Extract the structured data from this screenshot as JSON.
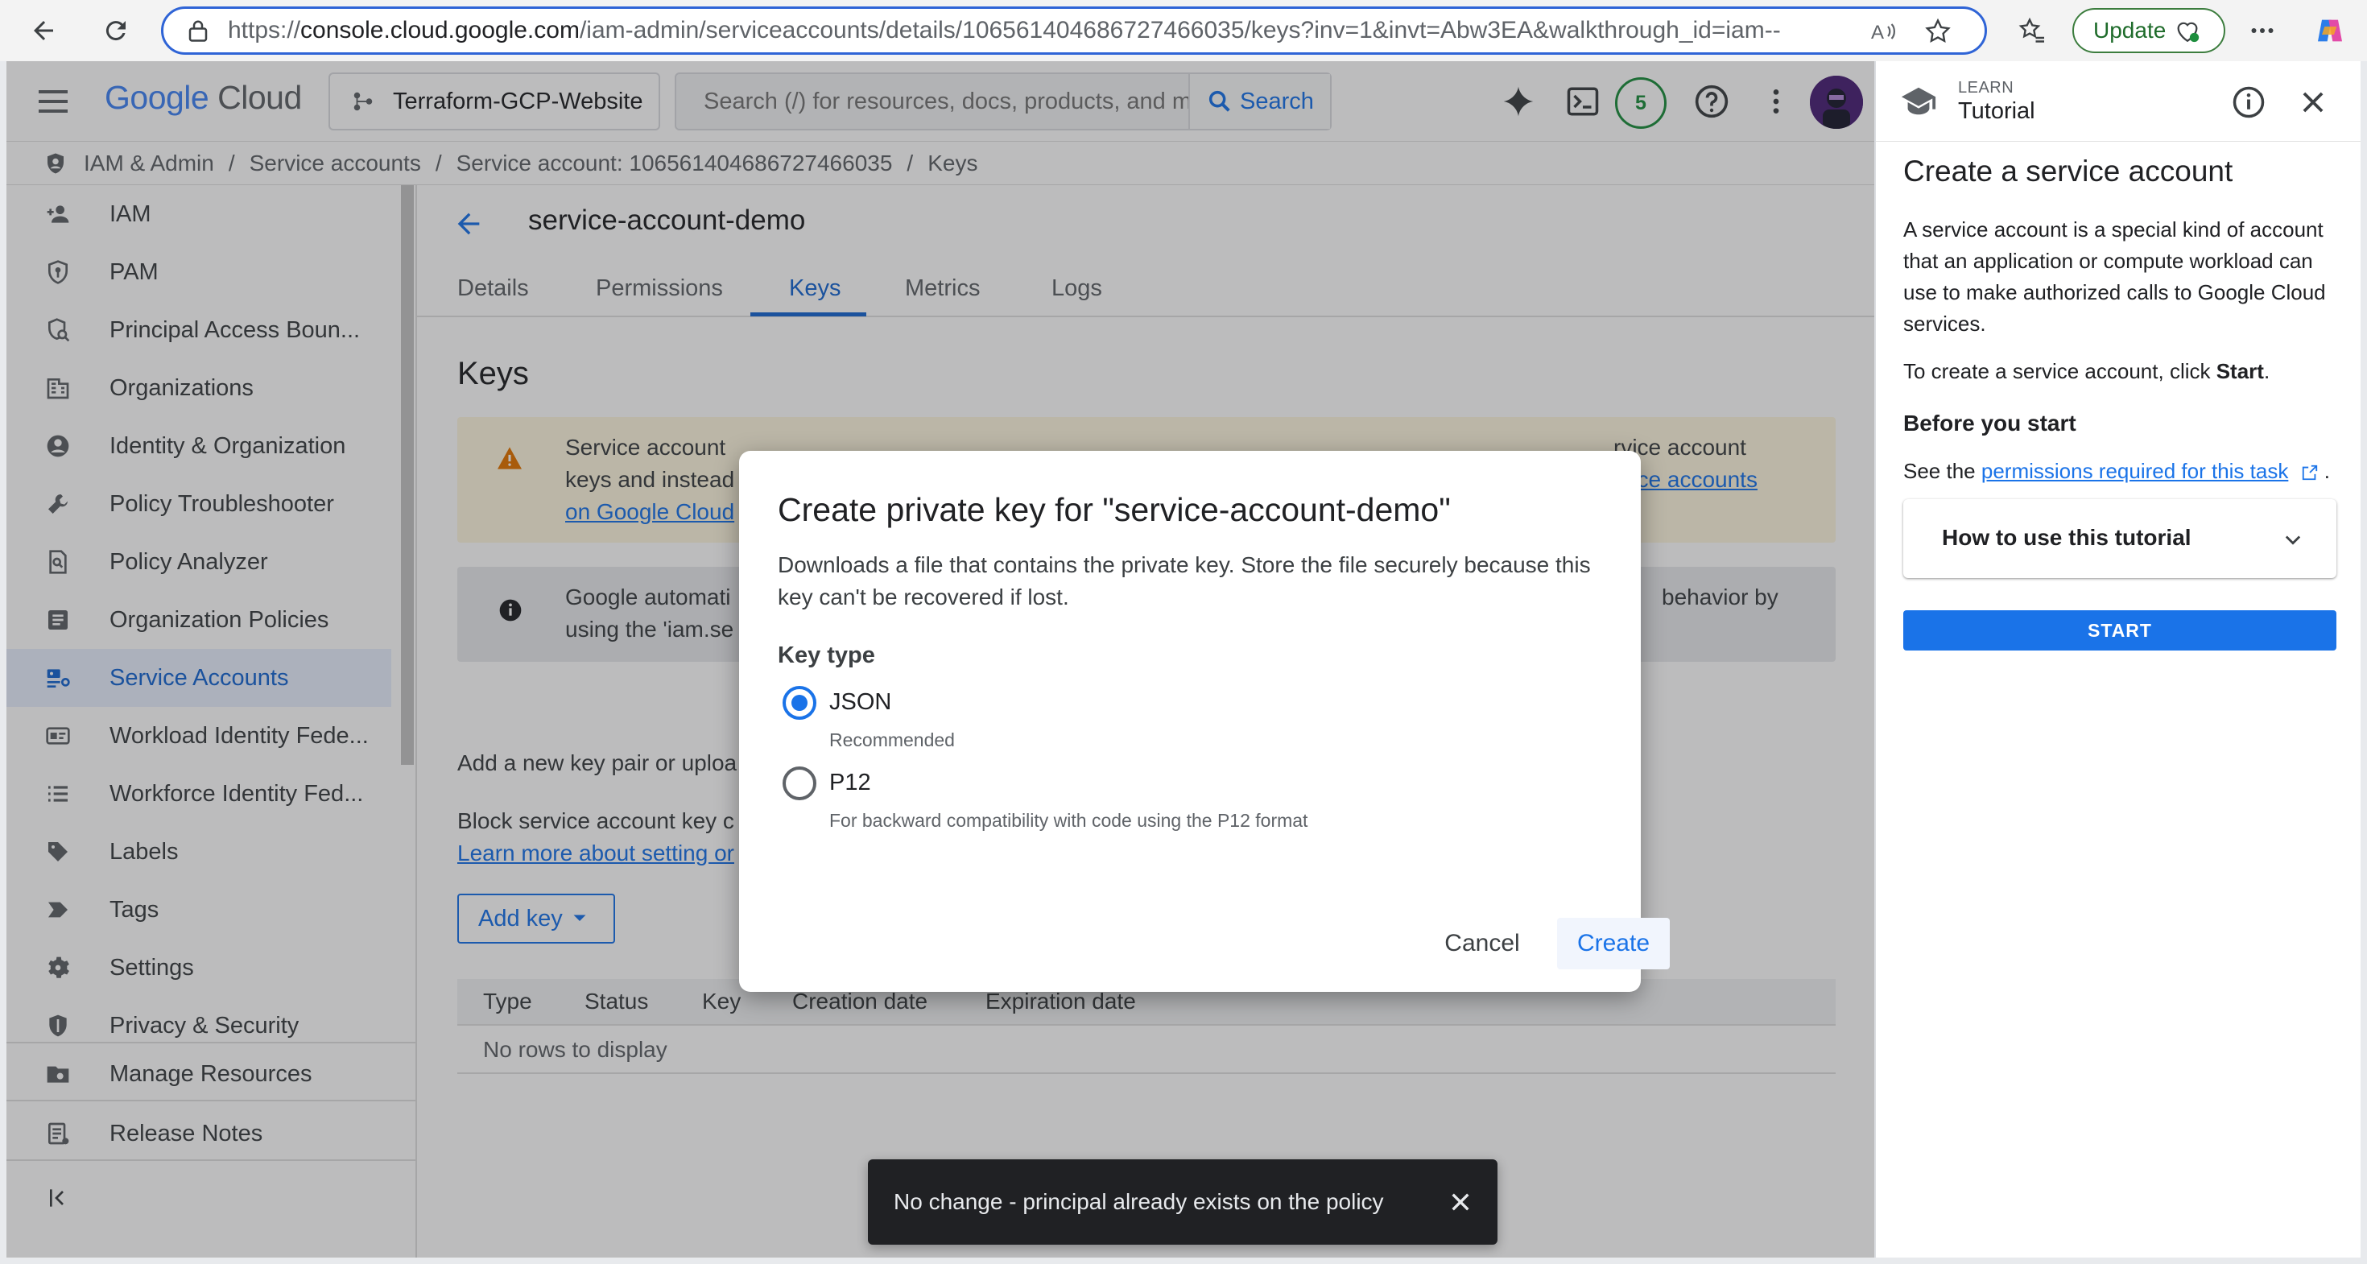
{
  "browser": {
    "url_prefix": "https://",
    "url_host": "console.cloud.google.com",
    "url_path": "/iam-admin/serviceaccounts/details/106561404686727466035/keys?inv=1&invt=Abw3EA&walkthrough_id=iam--cr...",
    "update_label": "Update"
  },
  "topnav": {
    "logo_google": "Google",
    "logo_cloud": "Cloud",
    "project_name": "Terraform-GCP-Website",
    "search_placeholder": "Search (/) for resources, docs, products, and more",
    "search_button": "Search",
    "notification_count": "5"
  },
  "breadcrumb": [
    "IAM & Admin",
    "Service accounts",
    "Service account: 106561404686727466035",
    "Keys"
  ],
  "sidebar": {
    "items": [
      {
        "label": "IAM",
        "icon": "person-add-icon"
      },
      {
        "label": "PAM",
        "icon": "shield-key-icon"
      },
      {
        "label": "Principal Access Boun...",
        "icon": "shield-search-icon"
      },
      {
        "label": "Organizations",
        "icon": "building-icon"
      },
      {
        "label": "Identity & Organization",
        "icon": "account-circle-icon"
      },
      {
        "label": "Policy Troubleshooter",
        "icon": "wrench-icon"
      },
      {
        "label": "Policy Analyzer",
        "icon": "document-search-icon"
      },
      {
        "label": "Organization Policies",
        "icon": "list-doc-icon"
      },
      {
        "label": "Service Accounts",
        "icon": "service-account-icon",
        "active": true
      },
      {
        "label": "Workload Identity Fede...",
        "icon": "id-card-icon"
      },
      {
        "label": "Workforce Identity Fed...",
        "icon": "list-icon"
      },
      {
        "label": "Labels",
        "icon": "label-icon"
      },
      {
        "label": "Tags",
        "icon": "tag-icon"
      },
      {
        "label": "Settings",
        "icon": "gear-icon"
      },
      {
        "label": "Privacy & Security",
        "icon": "shield-icon"
      }
    ],
    "manage_resources": "Manage Resources",
    "release_notes": "Release Notes"
  },
  "main": {
    "title": "service-account-demo",
    "tabs": [
      "Details",
      "Permissions",
      "Keys",
      "Metrics",
      "Logs"
    ],
    "active_tab": "Keys",
    "heading": "Keys",
    "warning": {
      "line1": "Service account",
      "line2": "keys and instead",
      "link_left": "on Google Cloud",
      "right_line1": "rvice account",
      "right_link": "rvice accounts"
    },
    "info": {
      "line1": "Google automati",
      "line2": "using the 'iam.se",
      "right_line1": "behavior by"
    },
    "add_new_text": "Add a new key pair or uploa",
    "block_text": "Block service account key c",
    "learn_more_link": "Learn more about setting or",
    "add_key_button": "Add key",
    "table": {
      "columns": [
        "Type",
        "Status",
        "Key",
        "Creation date",
        "Expiration date"
      ],
      "empty_text": "No rows to display"
    }
  },
  "dialog": {
    "title": "Create private key for \"service-account-demo\"",
    "description": "Downloads a file that contains the private key. Store the file securely because this key can't be recovered if lost.",
    "key_type_label": "Key type",
    "options": [
      {
        "label": "JSON",
        "sub": "Recommended",
        "checked": true
      },
      {
        "label": "P12",
        "sub": "For backward compatibility with code using the P12 format",
        "checked": false
      }
    ],
    "cancel": "Cancel",
    "create": "Create"
  },
  "tutorial": {
    "learn": "LEARN",
    "tutorial": "Tutorial",
    "title": "Create a service account",
    "description": "A service account is a special kind of account that an application or compute workload can use to make authorized calls to Google Cloud services.",
    "instruction_prefix": "To create a service account, click ",
    "instruction_bold": "Start",
    "instruction_suffix": ".",
    "before_start": "Before you start",
    "see_the": "See the ",
    "permissions_link": "permissions required for this task",
    "see_suffix": " .",
    "howto": "How to use this tutorial",
    "start_button": "START"
  },
  "snackbar": {
    "message": "No change - principal already exists on the policy"
  },
  "colors": {
    "accent": "#1a73e8",
    "active_nav_bg": "#e8f0fe",
    "warning_bg": "#fef7e0"
  }
}
